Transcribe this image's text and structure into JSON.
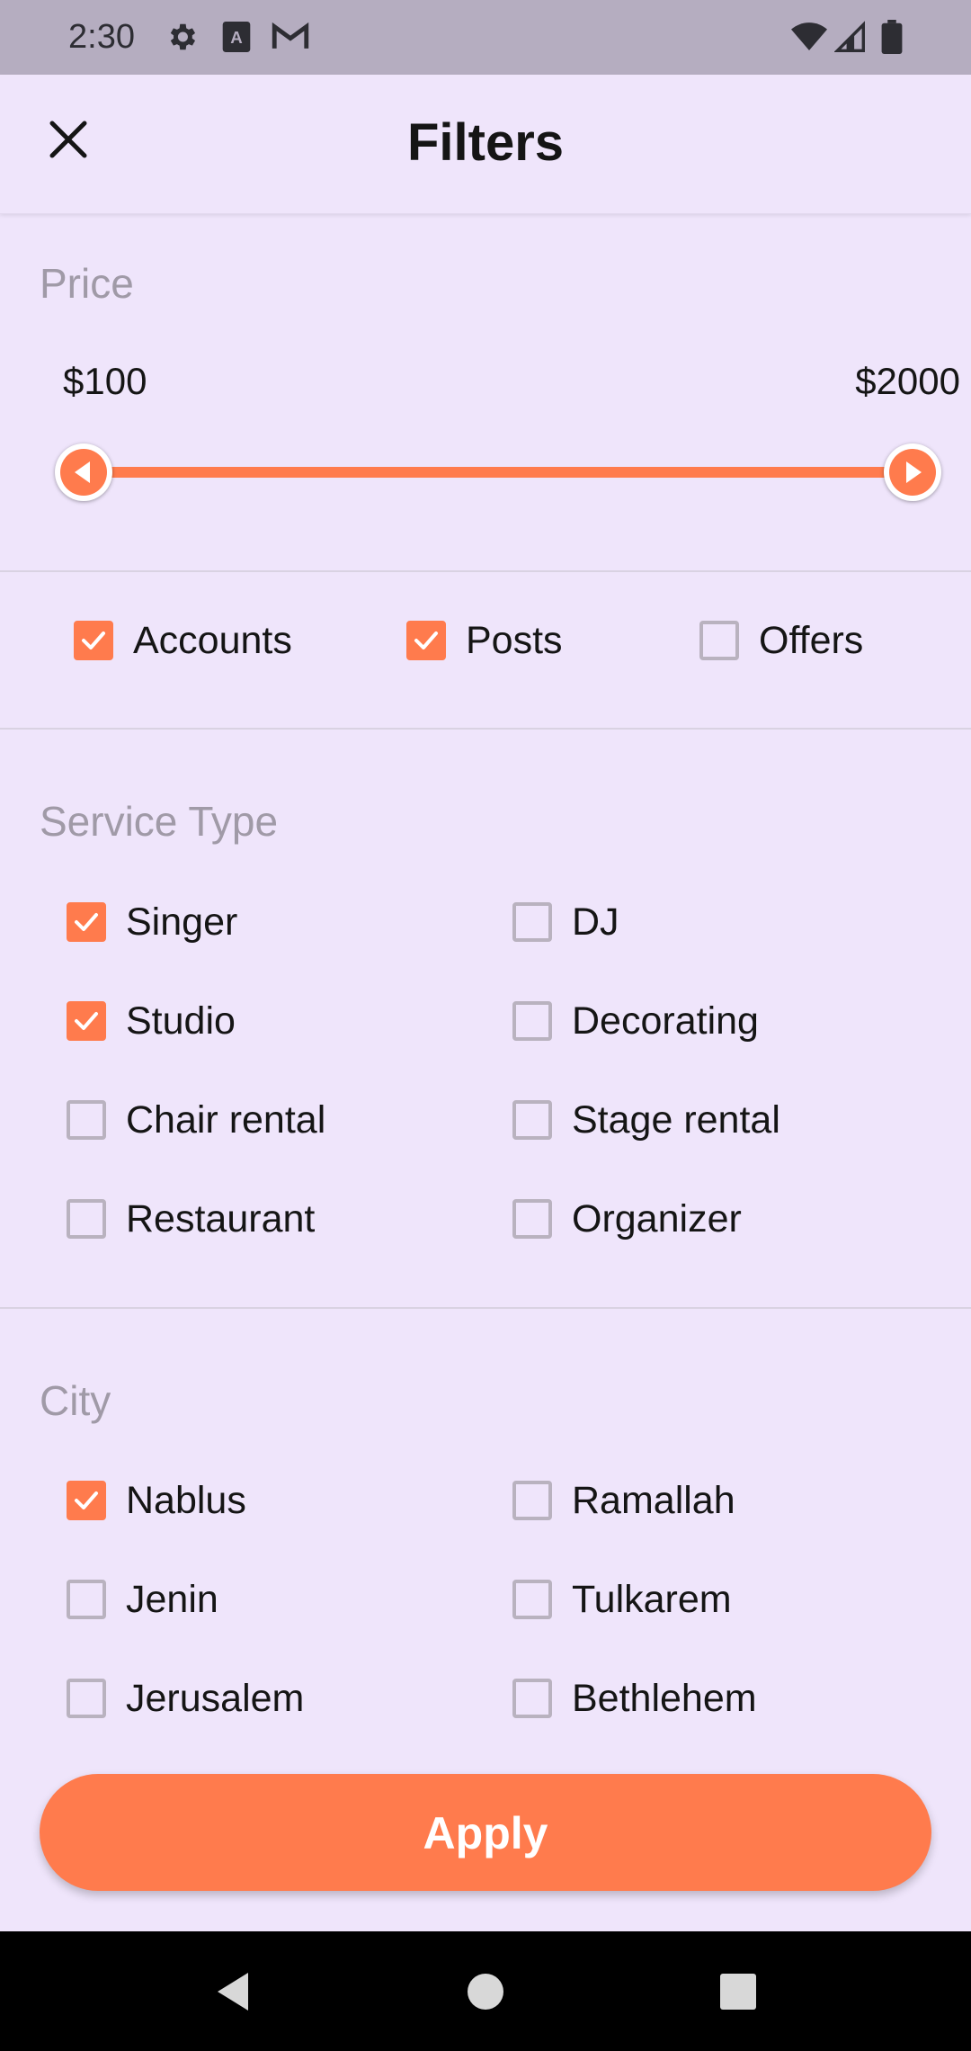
{
  "status_bar": {
    "time": "2:30",
    "left_icons": [
      "gear-icon",
      "font-download-icon",
      "gmail-icon"
    ],
    "right_icons": [
      "wifi-icon",
      "signal-icon",
      "battery-icon"
    ]
  },
  "app_bar": {
    "title": "Filters",
    "close_icon": "close-icon"
  },
  "price": {
    "section_title": "Price",
    "min_label": "$100",
    "max_label": "$2000",
    "range_low_fraction": 0.03,
    "range_high_fraction": 0.97
  },
  "content_types": [
    {
      "label": "Accounts",
      "checked": true
    },
    {
      "label": "Posts",
      "checked": true
    },
    {
      "label": "Offers",
      "checked": false
    }
  ],
  "service_type": {
    "section_title": "Service Type",
    "items": [
      {
        "label": "Singer",
        "checked": true
      },
      {
        "label": "DJ",
        "checked": false
      },
      {
        "label": "Studio",
        "checked": true
      },
      {
        "label": "Decorating",
        "checked": false
      },
      {
        "label": "Chair rental",
        "checked": false
      },
      {
        "label": "Stage rental",
        "checked": false
      },
      {
        "label": "Restaurant",
        "checked": false
      },
      {
        "label": "Organizer",
        "checked": false
      }
    ]
  },
  "city": {
    "section_title": "City",
    "items": [
      {
        "label": "Nablus",
        "checked": true
      },
      {
        "label": "Ramallah",
        "checked": false
      },
      {
        "label": "Jenin",
        "checked": false
      },
      {
        "label": "Tulkarem",
        "checked": false
      },
      {
        "label": "Jerusalem",
        "checked": false
      },
      {
        "label": "Bethlehem",
        "checked": false
      }
    ]
  },
  "apply_button": {
    "label": "Apply"
  },
  "colors": {
    "accent": "#ff7b4d",
    "background": "#efe5fb",
    "section_title": "#a09aa7",
    "checkbox_border": "#b9b2bf"
  },
  "nav_bar": {
    "buttons": [
      "back-icon",
      "home-icon",
      "recents-icon"
    ]
  }
}
